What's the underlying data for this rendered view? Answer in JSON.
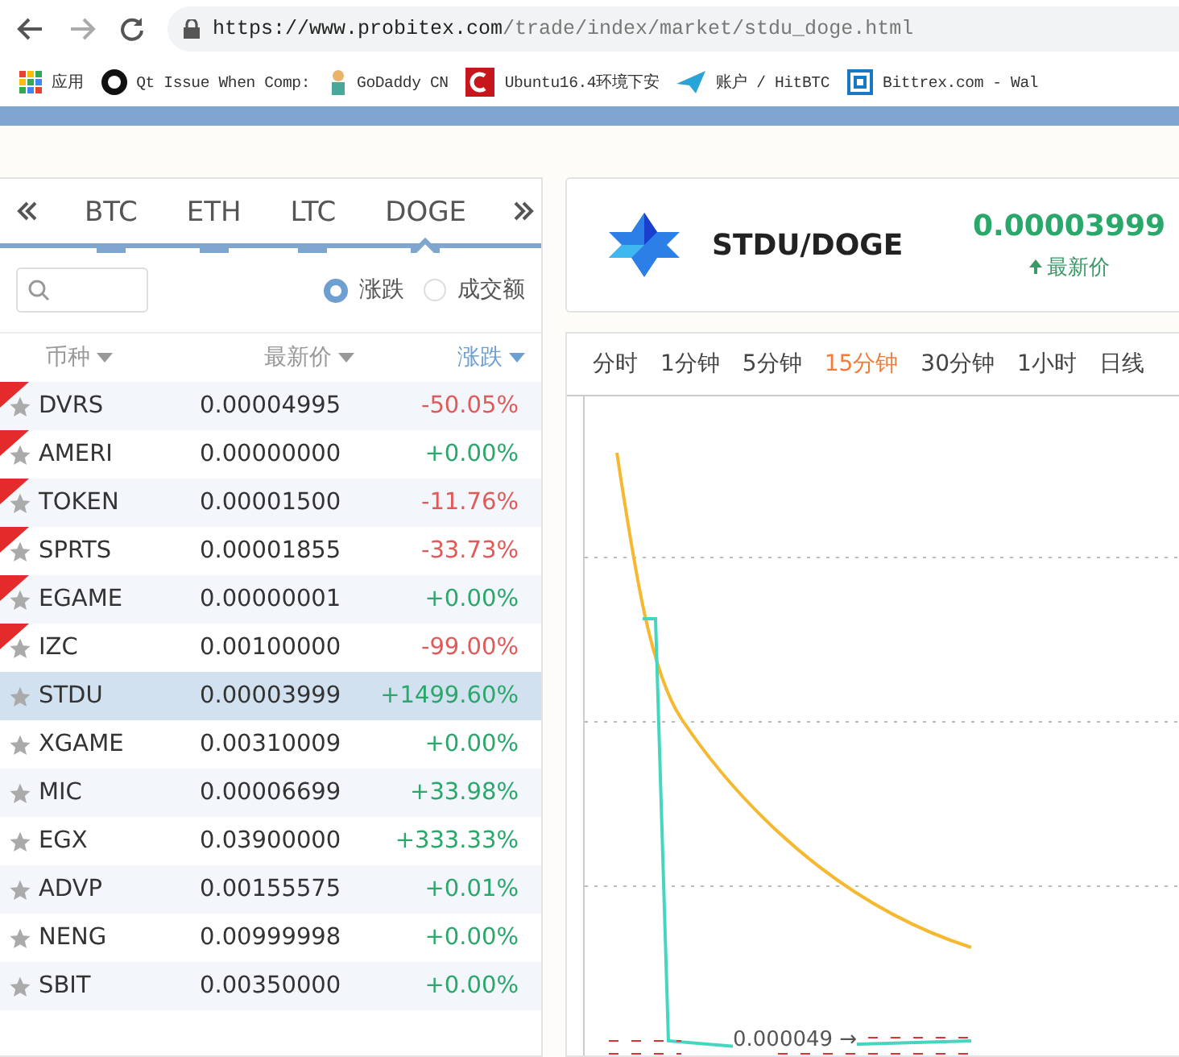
{
  "browser": {
    "url_host": "https://www.probitex.com",
    "url_path": "/trade/index/market/stdu_doge.html",
    "bookmarks": [
      {
        "kind": "apps",
        "label": "应用"
      },
      {
        "kind": "github",
        "label": "Qt Issue When Comp:"
      },
      {
        "kind": "godaddy",
        "label": "GoDaddy CN"
      },
      {
        "kind": "ubuntu",
        "label": "Ubuntu16.4环境下安"
      },
      {
        "kind": "hitbtc",
        "label": "账户 / HitBTC"
      },
      {
        "kind": "bittrex",
        "label": "Bittrex.com - Wal"
      }
    ]
  },
  "market_tabs": [
    {
      "label": "BTC",
      "selected": false
    },
    {
      "label": "ETH",
      "selected": false
    },
    {
      "label": "LTC",
      "selected": false
    },
    {
      "label": "DOGE",
      "selected": true
    }
  ],
  "sort_options": [
    {
      "label": "涨跌",
      "selected": true
    },
    {
      "label": "成交额",
      "selected": false
    }
  ],
  "columns": [
    {
      "label": "币种",
      "active": false
    },
    {
      "label": "最新价",
      "active": false
    },
    {
      "label": "涨跌",
      "active": true
    }
  ],
  "rows": [
    {
      "name": "DVRS",
      "price": "0.00004995",
      "change": "-50.05%",
      "kind": "down",
      "new": true,
      "selected": false
    },
    {
      "name": "AMERI",
      "price": "0.00000000",
      "change": "+0.00%",
      "kind": "up",
      "new": true,
      "selected": false
    },
    {
      "name": "TOKEN",
      "price": "0.00001500",
      "change": "-11.76%",
      "kind": "down",
      "new": true,
      "selected": false
    },
    {
      "name": "SPRTS",
      "price": "0.00001855",
      "change": "-33.73%",
      "kind": "down",
      "new": true,
      "selected": false
    },
    {
      "name": "EGAME",
      "price": "0.00000001",
      "change": "+0.00%",
      "kind": "up",
      "new": true,
      "selected": false
    },
    {
      "name": "IZC",
      "price": "0.00100000",
      "change": "-99.00%",
      "kind": "down",
      "new": true,
      "selected": false
    },
    {
      "name": "STDU",
      "price": "0.00003999",
      "change": "+1499.60%",
      "kind": "up",
      "new": false,
      "selected": true
    },
    {
      "name": "XGAME",
      "price": "0.00310009",
      "change": "+0.00%",
      "kind": "up",
      "new": false,
      "selected": false
    },
    {
      "name": "MIC",
      "price": "0.00006699",
      "change": "+33.98%",
      "kind": "up",
      "new": false,
      "selected": false
    },
    {
      "name": "EGX",
      "price": "0.03900000",
      "change": "+333.33%",
      "kind": "up",
      "new": false,
      "selected": false
    },
    {
      "name": "ADVP",
      "price": "0.00155575",
      "change": "+0.01%",
      "kind": "up",
      "new": false,
      "selected": false
    },
    {
      "name": "NENG",
      "price": "0.00999998",
      "change": "+0.00%",
      "kind": "up",
      "new": false,
      "selected": false
    },
    {
      "name": "SBIT",
      "price": "0.00350000",
      "change": "+0.00%",
      "kind": "up",
      "new": false,
      "selected": false
    }
  ],
  "pair": {
    "name": "STDU/DOGE",
    "price": "0.00003999",
    "price_label": "最新价"
  },
  "periods": [
    {
      "label": "分时",
      "selected": false
    },
    {
      "label": "1分钟",
      "selected": false
    },
    {
      "label": "5分钟",
      "selected": false
    },
    {
      "label": "15分钟",
      "selected": true
    },
    {
      "label": "30分钟",
      "selected": false
    },
    {
      "label": "1小时",
      "selected": false
    },
    {
      "label": "日线",
      "selected": false
    }
  ],
  "chart": {
    "price_note": "0.000049 →"
  }
}
